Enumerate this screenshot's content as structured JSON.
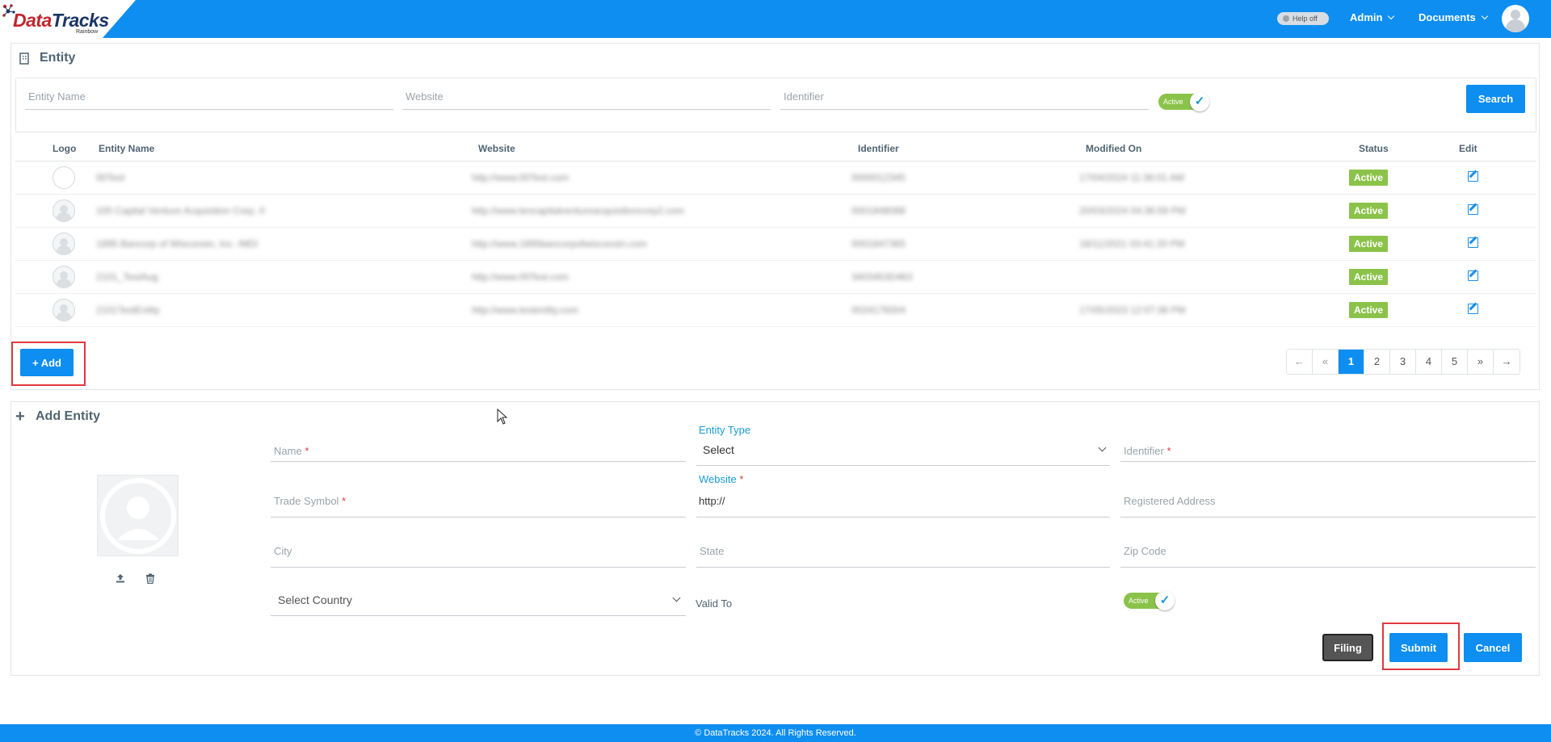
{
  "app": {
    "logo_text_a": "Data",
    "logo_text_b": "Tracks",
    "logo_sub": "Rainbow"
  },
  "header": {
    "help_toggle": "Help off",
    "admin_menu": "Admin",
    "documents_menu": "Documents"
  },
  "entity_section": {
    "title": "Entity",
    "filters": {
      "entity_name_placeholder": "Entity Name",
      "website_placeholder": "Website",
      "identifier_placeholder": "Identifier",
      "active_toggle": "Active",
      "search_button": "Search"
    },
    "table": {
      "columns": [
        "Logo",
        "Entity Name",
        "Website",
        "Identifier",
        "Modified On",
        "Status",
        "Edit"
      ],
      "rows": [
        {
          "name": "00Test",
          "website": "http://www.00Test.com",
          "identifier": "0000012345",
          "modified": "17/04/2024 11:36:01 AM",
          "status": "Active"
        },
        {
          "name": "100 Capital Venture Acquisition Corp. II",
          "website": "http://www.tencapitalventureacquisitioncorp2.com",
          "identifier": "0001848088",
          "modified": "20/03/2024 04:36:59 PM",
          "status": "Active"
        },
        {
          "name": "1895 Bancorp of Wisconsin, Inc. /MD/",
          "website": "http://www.1895bancorpofwisconsin.com",
          "identifier": "0001847365",
          "modified": "18/11/2021 03:41:20 PM",
          "status": "Active"
        },
        {
          "name": "2101_TestAug",
          "website": "http://www.00Test.com",
          "identifier": "3403453D463",
          "modified": "",
          "status": "Active"
        },
        {
          "name": "2101TestEntity",
          "website": "http://www.testentity.com",
          "identifier": "0024176004",
          "modified": "17/05/2023 12:07:38 PM",
          "status": "Active"
        }
      ]
    },
    "add_button": "+ Add",
    "pagination": {
      "prev": "←",
      "first": "«",
      "pages": [
        "1",
        "2",
        "3",
        "4",
        "5"
      ],
      "last": "»",
      "next": "→",
      "current": "1"
    }
  },
  "add_entity": {
    "title": "Add Entity",
    "fields": {
      "name": "Name",
      "entity_type_label": "Entity Type",
      "entity_type_value": "Select",
      "identifier": "Identifier",
      "trade_symbol": "Trade Symbol",
      "website_label": "Website",
      "website_value": "http://",
      "registered_address": "Registered Address",
      "city": "City",
      "state": "State",
      "zip_code": "Zip Code",
      "country_value": "Select Country",
      "valid_to": "Valid To",
      "active_toggle": "Active",
      "required_mark": "*"
    },
    "buttons": {
      "filing": "Filing",
      "submit": "Submit",
      "cancel": "Cancel"
    }
  },
  "footer": {
    "text": "© DataTracks 2024. All Rights Reserved."
  },
  "colors": {
    "primary": "#0d8ef0",
    "active_green": "#8bc34a",
    "highlight_red": "#e0393e"
  }
}
